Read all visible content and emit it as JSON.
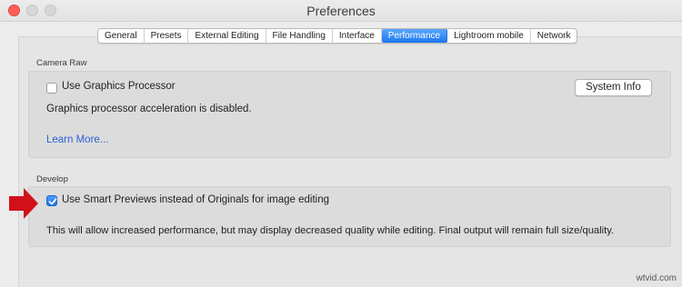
{
  "window": {
    "title": "Preferences"
  },
  "tabs": [
    {
      "label": "General",
      "active": false
    },
    {
      "label": "Presets",
      "active": false
    },
    {
      "label": "External Editing",
      "active": false
    },
    {
      "label": "File Handling",
      "active": false
    },
    {
      "label": "Interface",
      "active": false
    },
    {
      "label": "Performance",
      "active": true
    },
    {
      "label": "Lightroom mobile",
      "active": false
    },
    {
      "label": "Network",
      "active": false
    }
  ],
  "camera_raw": {
    "section_title": "Camera Raw",
    "use_gpu_label": "Use Graphics Processor",
    "use_gpu_checked": false,
    "system_info_label": "System Info",
    "status_text": "Graphics processor acceleration is disabled.",
    "learn_more_label": "Learn More..."
  },
  "develop": {
    "section_title": "Develop",
    "smart_previews_label": "Use Smart Previews instead of Originals for image editing",
    "smart_previews_checked": true,
    "description": "This will allow increased performance, but may display decreased quality while editing. Final output will remain full size/quality."
  },
  "annotation": {
    "arrow_color": "#d0101a",
    "icon": "red-arrow-icon"
  },
  "watermark": "wtvid.com"
}
